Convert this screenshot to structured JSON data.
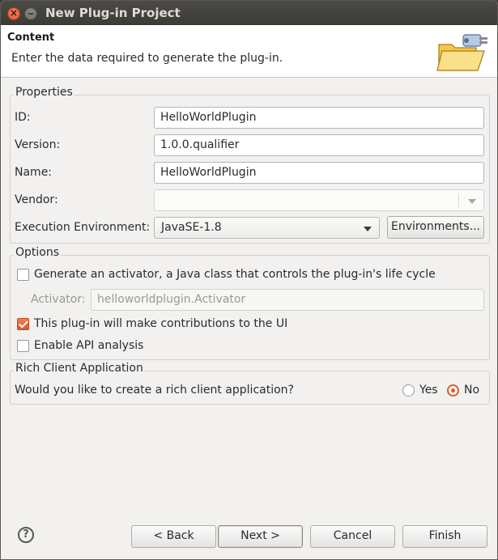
{
  "window": {
    "title": "New Plug-in Project"
  },
  "header": {
    "title": "Content",
    "message": "Enter the data required to generate the plug-in."
  },
  "properties": {
    "label": "Properties",
    "id_label": "ID:",
    "id_value": "HelloWorldPlugin",
    "version_label": "Version:",
    "version_value": "1.0.0.qualifier",
    "name_label": "Name:",
    "name_value": "HelloWorldPlugin",
    "vendor_label": "Vendor:",
    "vendor_value": "",
    "exec_env_label": "Execution Environment:",
    "exec_env_value": "JavaSE-1.8",
    "environments_button": "Environments..."
  },
  "options": {
    "label": "Options",
    "generate_activator": {
      "label": "Generate an activator, a Java class that controls the plug-in's life cycle",
      "checked": false
    },
    "activator_label": "Activator:",
    "activator_value": "helloworldplugin.Activator",
    "contributions": {
      "label": "This plug-in will make contributions to the UI",
      "checked": true
    },
    "api_analysis": {
      "label": "Enable API analysis",
      "checked": false
    }
  },
  "rca": {
    "label": "Rich Client Application",
    "question": "Would you like to create a rich client application?",
    "yes_label": "Yes",
    "no_label": "No",
    "selected": "No"
  },
  "footer": {
    "help_glyph": "?",
    "back": "< Back",
    "next": "Next >",
    "cancel": "Cancel",
    "finish": "Finish"
  },
  "colors": {
    "accent": "#e0592a",
    "titlebar": "#3c3b37"
  }
}
